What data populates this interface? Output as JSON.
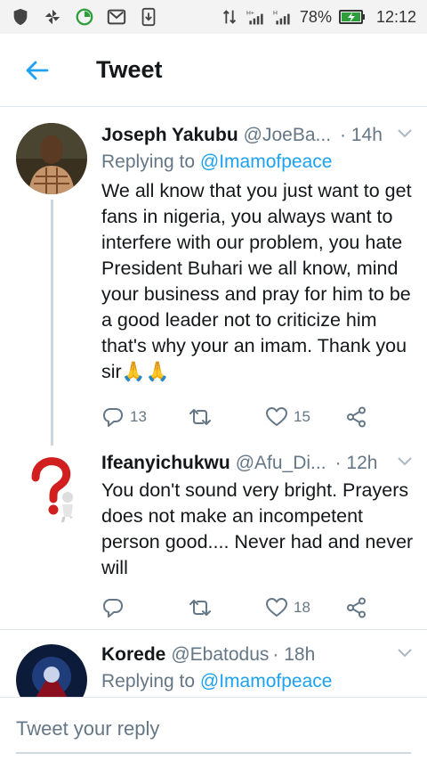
{
  "status_bar": {
    "battery_percent": "78%",
    "time": "12:12",
    "signal_label_1": "H+",
    "signal_label_2": "H"
  },
  "header": {
    "title": "Tweet"
  },
  "tweets": [
    {
      "author": "Joseph Yakubu",
      "handle": "@JoeBa...",
      "time": "· 14h",
      "replying_prefix": "Replying to",
      "replying_to": "@Imamofpeace",
      "text": "We all know that you just want to get fans in nigeria, you always want to interfere with our problem, you hate President Buhari we all know, mind your business and pray for him to be a good leader not to criticize him that's why your an imam. Thank you sir🙏🙏",
      "replies": "13",
      "retweets": "",
      "likes": "15"
    },
    {
      "author": "Ifeanyichukwu",
      "handle": "@Afu_Di...",
      "time": "· 12h",
      "text": "You don't sound very bright. Prayers does not make an incompetent person good.... Never had and never will",
      "replies": "",
      "retweets": "",
      "likes": "18"
    },
    {
      "author": "Korede",
      "handle": "@Ebatodus",
      "time": "· 18h",
      "replying_prefix": "Replying to",
      "replying_to": "@Imamofpeace"
    }
  ],
  "composer": {
    "placeholder": "Tweet your reply"
  },
  "colors": {
    "accent": "#1da1f2",
    "muted": "#657786",
    "text": "#14171a",
    "divider": "#e1e8ed"
  }
}
